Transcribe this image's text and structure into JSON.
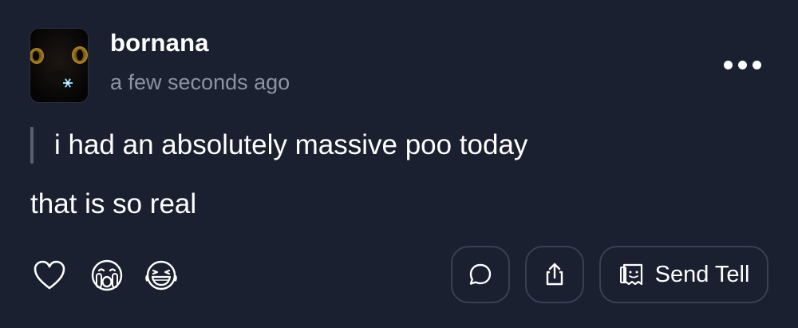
{
  "post": {
    "username": "bornana",
    "timestamp": "a few seconds ago",
    "quote": "i had an absolutely massive poo today",
    "reply": "that is so real"
  },
  "actions": {
    "like_icon": "heart-icon",
    "cry_icon": "crying-face-icon",
    "laugh_icon": "laughing-face-icon",
    "comment_icon": "comment-bubble-icon",
    "share_icon": "share-icon",
    "send_tell_icon": "tell-card-icon",
    "send_tell_label": "Send Tell",
    "more_icon": "more-dots-icon"
  },
  "colors": {
    "background": "#1b2030",
    "muted_text": "#8d93a3",
    "border": "#3a4052",
    "quote_bar": "#5a6071",
    "avatar_sticker": "#8fd0f2"
  }
}
